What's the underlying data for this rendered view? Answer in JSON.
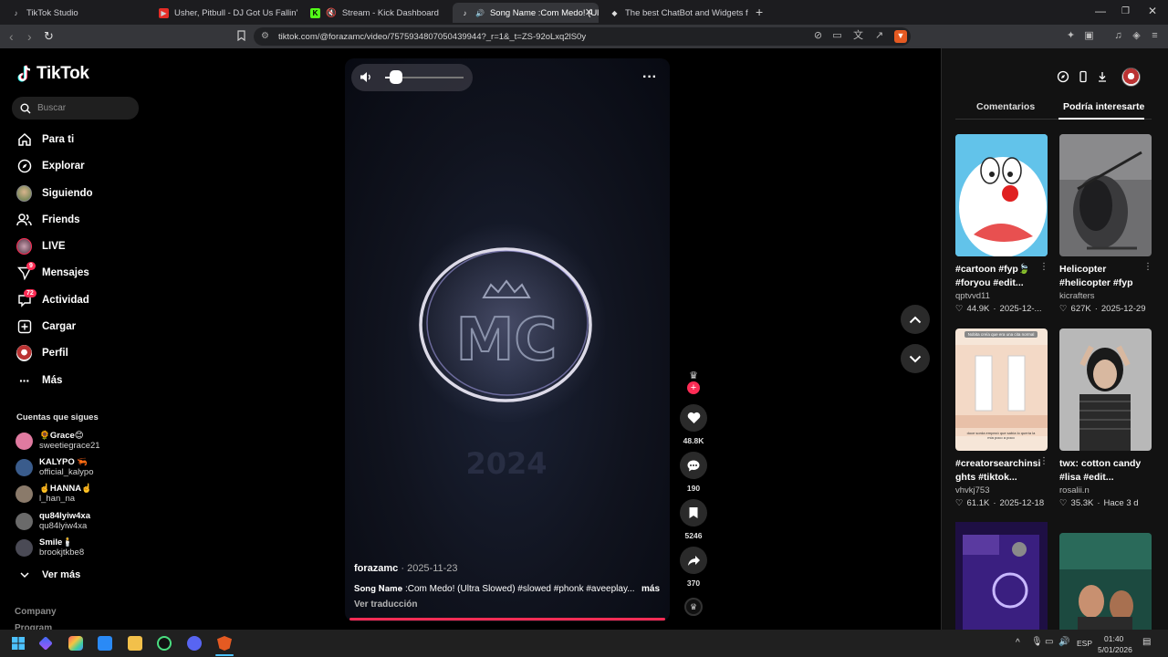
{
  "browser": {
    "tabs": [
      {
        "title": "TikTok Studio",
        "icon": "tiktok-icon"
      },
      {
        "title": "Usher, Pitbull - DJ Got Us Fallin' In Lo",
        "icon": "youtube-icon"
      },
      {
        "title": "Stream - Kick Dashboard",
        "icon": "kick-icon"
      },
      {
        "title": "Song Name :Com Medo! (Ult",
        "icon": "tiktok-icon"
      },
      {
        "title": "The best ChatBot and Widgets for Ki",
        "icon": "bot-icon"
      }
    ],
    "new_tab": "+",
    "url": "tiktok.com/@forazamc/video/7575934807050439944?_r=1&_t=ZS-92oLxq2lS0y"
  },
  "sidebar": {
    "logo": "TikTok",
    "search_placeholder": "Buscar",
    "nav": [
      {
        "label": "Para ti",
        "icon": "home-icon"
      },
      {
        "label": "Explorar",
        "icon": "compass-icon"
      },
      {
        "label": "Siguiendo",
        "icon": "following-avatar-icon"
      },
      {
        "label": "Friends",
        "icon": "friends-icon"
      },
      {
        "label": "LIVE",
        "icon": "live-icon"
      },
      {
        "label": "Mensajes",
        "icon": "messages-icon",
        "badge": "9"
      },
      {
        "label": "Actividad",
        "icon": "activity-icon",
        "badge": "72"
      },
      {
        "label": "Cargar",
        "icon": "upload-icon"
      },
      {
        "label": "Perfil",
        "icon": "profile-icon"
      },
      {
        "label": "Más",
        "icon": "more-icon"
      }
    ],
    "following_header": "Cuentas que sigues",
    "following": [
      {
        "name": "🌻Grace😊",
        "user": "sweetiegrace21",
        "color": "#e07aa0"
      },
      {
        "name": "KALYPO 🦐",
        "user": "official_kalypo",
        "color": "#3a5c8c"
      },
      {
        "name": "☝️HANNA☝️",
        "user": "l_han_na",
        "color": "#8a7a6a"
      },
      {
        "name": "qu84lyiw4xa",
        "user": "qu84lyiw4xa",
        "color": "#6a6a6a"
      },
      {
        "name": "Smile🕯️",
        "user": "brookjtkbe8",
        "color": "#4a4a55"
      }
    ],
    "see_more": "Ver más",
    "footer": [
      "Company",
      "Program"
    ]
  },
  "video": {
    "author": "forazamc",
    "date": "2025-11-23",
    "caption_prefix": "𝐒𝐨𝐧𝐠 𝐍𝐚𝐦𝐞",
    "caption": ":Com Medo! (Ultra Slowed) #slowed #phonk #aveeplay...",
    "more": "más",
    "translate": "Ver traducción",
    "logo_text": "MC",
    "volume_fraction": 0.1
  },
  "actions": {
    "likes": "48.8K",
    "comments": "190",
    "saves": "5246",
    "shares": "370"
  },
  "right_panel": {
    "tabs": [
      "Comentarios",
      "Podría interesarte"
    ],
    "active_tab": 1,
    "cards": [
      {
        "title_l1": "#cartoon #fyp🍃",
        "title_l2": "#foryou #edit...",
        "user": "qptvvd11",
        "likes": "44.9K",
        "date": "2025-12-..."
      },
      {
        "title_l1": "Helicopter",
        "title_l2": "#helicopter #fyp",
        "user": "kicrafters",
        "likes": "627K",
        "date": "2025-12-29"
      },
      {
        "title_l1": "#creatorsearchinsi",
        "title_l2": "ghts #tiktok...",
        "user": "vhvkj753",
        "likes": "61.1K",
        "date": "2025-12-18"
      },
      {
        "title_l1": "twx: cotton candy",
        "title_l2": "#lisa #edit...",
        "user": "rosalii.n",
        "likes": "35.3K",
        "date": "Hace 3 d"
      }
    ],
    "card3_overlay": "Nobita creía que era una cita normal",
    "card3_overlay2": "doce sorda empezó que sabía lo quería la mía poco a poco"
  },
  "taskbar": {
    "time": "01:40",
    "date": "5/01/2026",
    "lang": "ESP"
  }
}
